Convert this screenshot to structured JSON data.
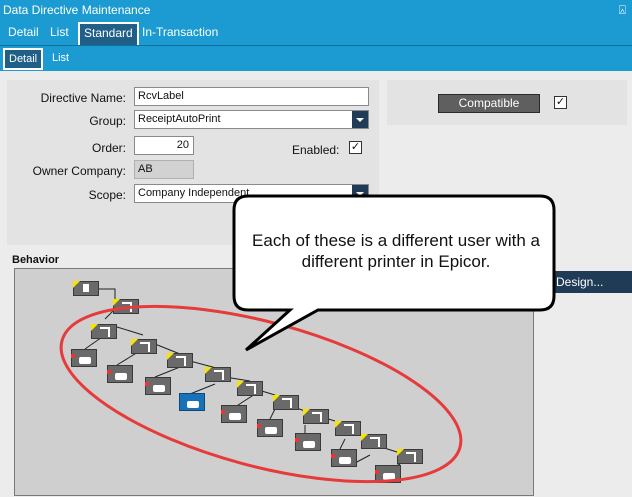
{
  "window": {
    "title": "Data Directive Maintenance",
    "pin_glyph": "⍓"
  },
  "main_tabs": [
    "Detail",
    "List",
    "Standard",
    "In-Transaction"
  ],
  "sub_tabs": [
    "Detail",
    "List"
  ],
  "form": {
    "directive_name_label": "Directive Name:",
    "directive_name_value": "RcvLabel",
    "group_label": "Group:",
    "group_value": "ReceiptAutoPrint",
    "order_label": "Order:",
    "order_value": "20",
    "enabled_label": "Enabled:",
    "enabled_checked": "✓",
    "owner_company_label": "Owner Company:",
    "owner_company_value": "AB",
    "scope_label": "Scope:",
    "scope_value": "Company Independent"
  },
  "compat": {
    "button_label": "Compatible",
    "checked": "✓"
  },
  "behavior": {
    "label": "Behavior",
    "design_button": "Design..."
  },
  "callout": {
    "text": "Each of these is a different user with a different printer in Epicor."
  }
}
